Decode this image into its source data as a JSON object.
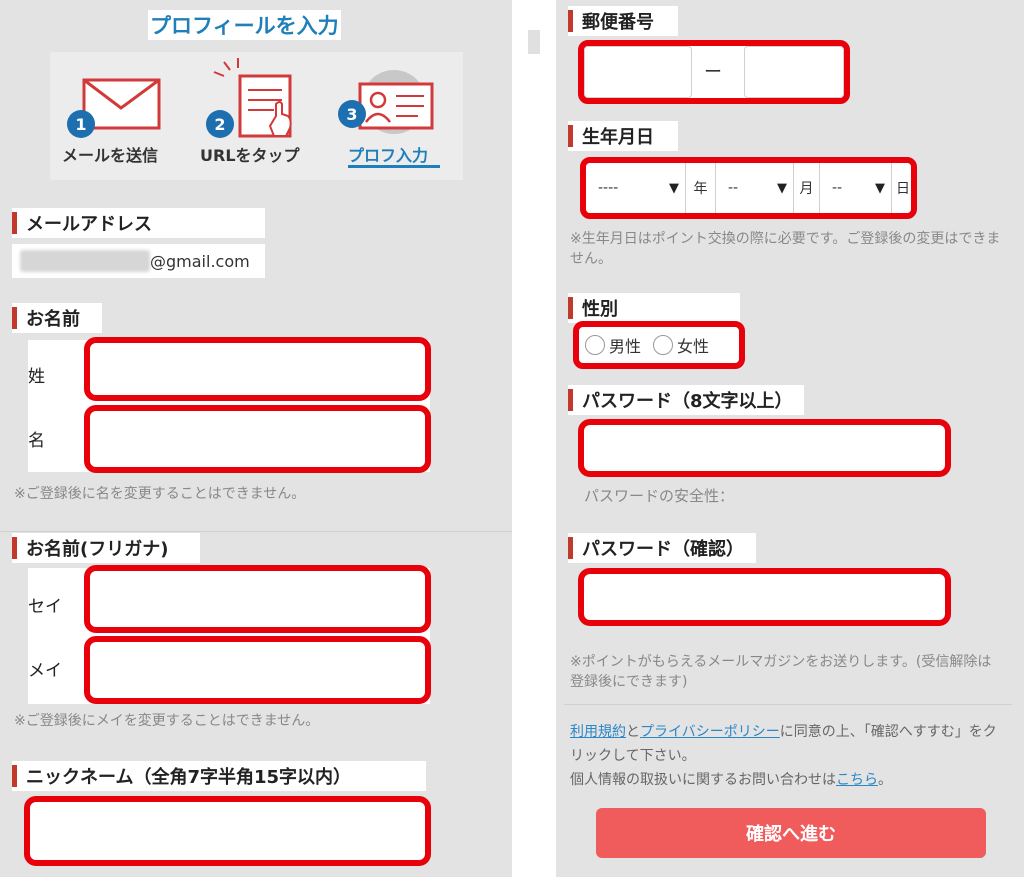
{
  "header": {
    "title": "プロフィールを入力"
  },
  "steps": [
    {
      "number": "1",
      "label": "メールを送信"
    },
    {
      "number": "2",
      "label": "URLをタップ"
    },
    {
      "number": "3",
      "label": "プロフ入力"
    }
  ],
  "email": {
    "label": "メールアドレス",
    "domain": "@gmail.com"
  },
  "name": {
    "label": "お名前",
    "last_label": "姓",
    "first_label": "名",
    "note": "※ご登録後に名を変更することはできません。"
  },
  "furigana": {
    "label": "お名前(フリガナ)",
    "sei_label": "セイ",
    "mei_label": "メイ",
    "note": "※ご登録後にメイを変更することはできません。"
  },
  "nickname": {
    "label": "ニックネーム（全角7字半角15字以内）"
  },
  "postal": {
    "label": "郵便番号",
    "separator": "ー"
  },
  "birthday": {
    "label": "生年月日",
    "year_value": "----",
    "year_unit": "年",
    "month_value": "--",
    "month_unit": "月",
    "day_value": "--",
    "day_unit": "日",
    "note": "※生年月日はポイント交換の際に必要です。ご登録後の変更はできません。"
  },
  "gender": {
    "label": "性別",
    "male": "男性",
    "female": "女性"
  },
  "password": {
    "label": "パスワード（8文字以上）",
    "strength_label": "パスワードの安全性："
  },
  "password_confirm": {
    "label": "パスワード（確認）"
  },
  "magazine_note": "※ポイントがもらえるメールマガジンをお送りします。(受信解除は登録後にできます)",
  "terms": {
    "terms_link": "利用規約",
    "and": "と",
    "privacy_link": "プライバシーポリシー",
    "agree_text": "に同意の上、「確認へすすむ」をクリックして下さい。",
    "contact_text": "個人情報の取扱いに関するお問い合わせは",
    "contact_link": "こちら",
    "contact_end": "。"
  },
  "confirm_button": "確認へ進む",
  "colors": {
    "accent_red": "#e8000b",
    "link_blue": "#2a87c8",
    "button": "#f05b5b",
    "title_blue": "#1f7fb8"
  }
}
